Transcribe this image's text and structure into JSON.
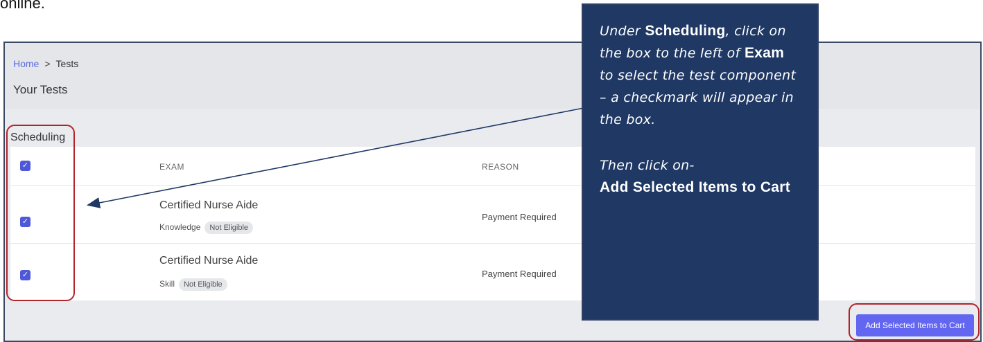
{
  "intro": {
    "text": "online."
  },
  "breadcrumb": {
    "home": "Home",
    "separator": ">",
    "current": "Tests"
  },
  "page": {
    "title": "Your Tests"
  },
  "section": {
    "label": "Scheduling"
  },
  "table": {
    "headers": {
      "exam": "EXAM",
      "reason": "REASON"
    },
    "rows": [
      {
        "exam": "Certified Nurse Aide",
        "type": "Knowledge",
        "eligibility": "Not Eligible",
        "reason": "Payment Required",
        "checked": true
      },
      {
        "exam": "Certified Nurse Aide",
        "type": "Skill",
        "eligibility": "Not Eligible",
        "reason": "Payment Required",
        "checked": true
      }
    ]
  },
  "actions": {
    "add_to_cart": "Add Selected Items to Cart"
  },
  "callout": {
    "under": "Under",
    "scheduling": "Scheduling",
    "comma": ",",
    "line2": "click on the box to the left of",
    "exam": "Exam",
    "line3": "to select the test component – a checkmark will appear in the box.",
    "then": "Then click on-",
    "action": "Add Selected Items to Cart"
  },
  "colors": {
    "accent": "#6366f1",
    "callout_bg": "#1f3864",
    "highlight": "#b3232a",
    "link": "#5b6bdc"
  }
}
